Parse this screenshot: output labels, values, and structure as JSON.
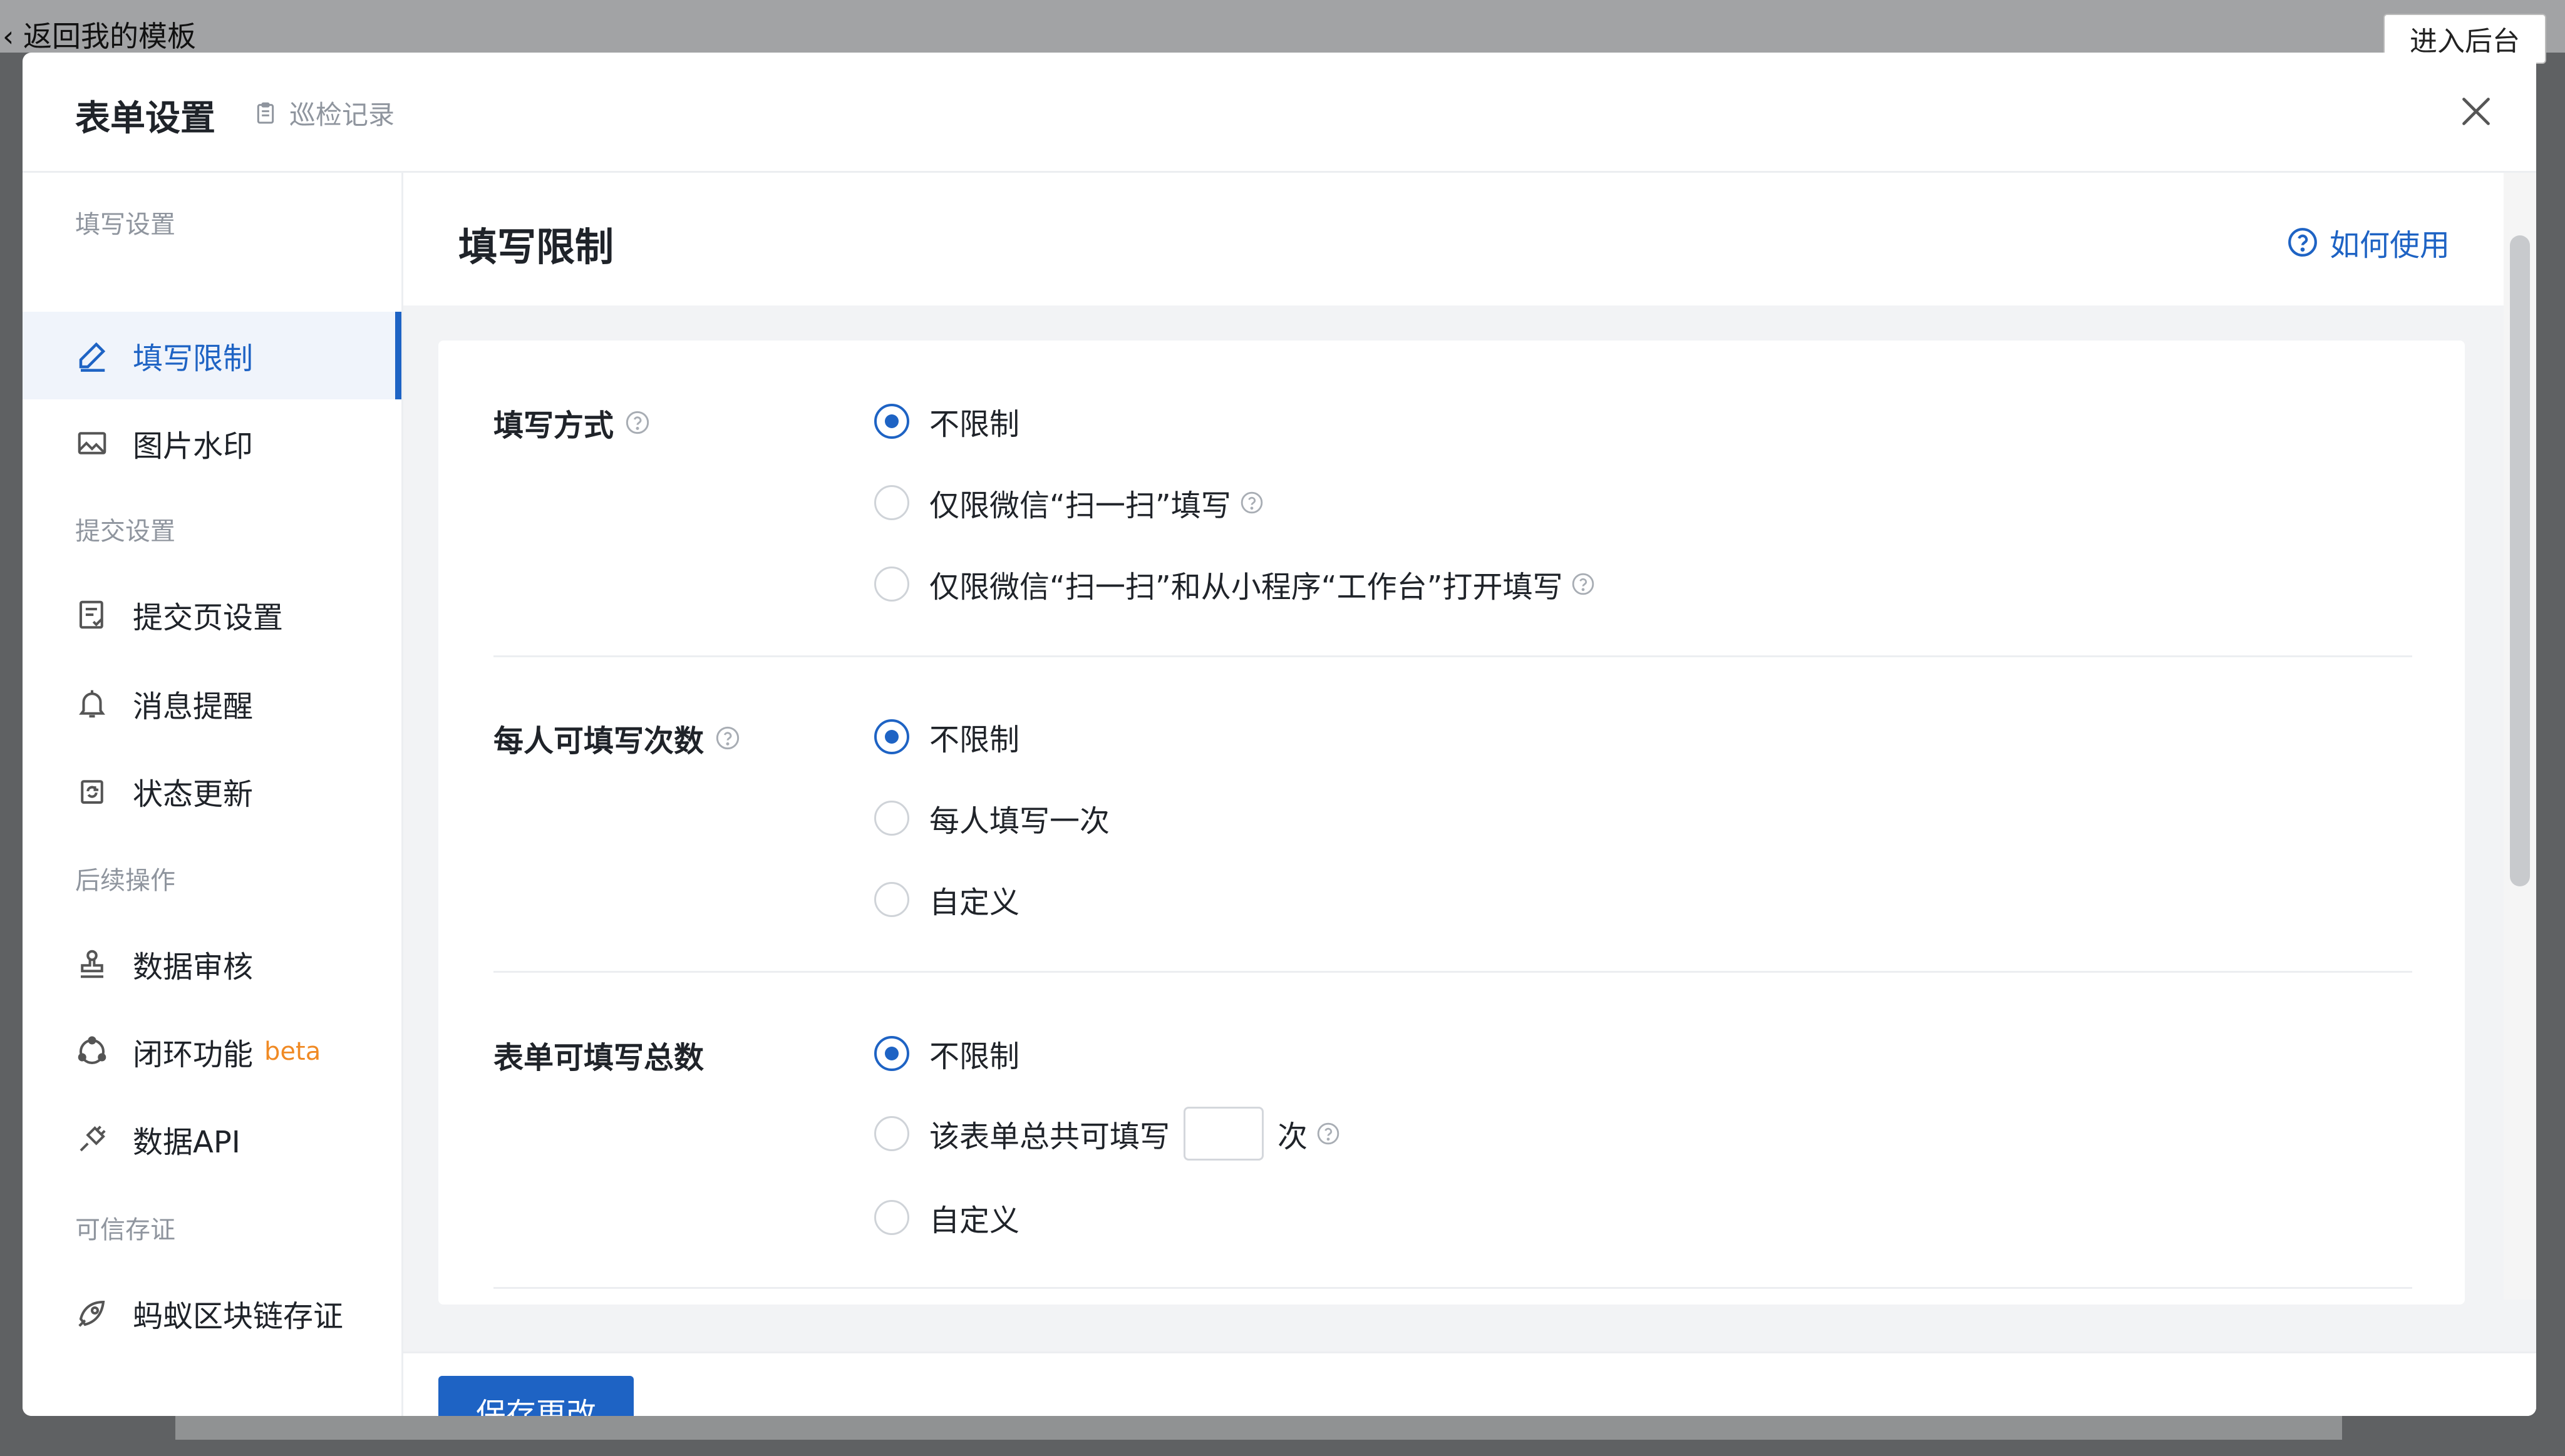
{
  "background": {
    "back_label": "返回我的模板",
    "enter_admin_label": "进入后台"
  },
  "modal": {
    "title": "表单设置",
    "patrol_link": "巡检记录",
    "close_icon": "close-icon"
  },
  "sidebar": {
    "groups": [
      {
        "title": "填写设置",
        "items": [
          {
            "label": "填写限制",
            "icon": "pencil-icon",
            "active": true
          },
          {
            "label": "图片水印",
            "icon": "image-icon",
            "active": false
          }
        ]
      },
      {
        "title": "提交设置",
        "items": [
          {
            "label": "提交页设置",
            "icon": "document-check-icon",
            "active": false
          },
          {
            "label": "消息提醒",
            "icon": "bell-icon",
            "active": false
          },
          {
            "label": "状态更新",
            "icon": "refresh-icon",
            "active": false
          }
        ]
      },
      {
        "title": "后续操作",
        "items": [
          {
            "label": "数据审核",
            "icon": "stamp-icon",
            "active": false
          },
          {
            "label": "闭环功能",
            "badge": "beta",
            "icon": "loop-icon",
            "active": false
          },
          {
            "label": "数据API",
            "icon": "plug-icon",
            "active": false
          }
        ]
      },
      {
        "title": "可信存证",
        "items": [
          {
            "label": "蚂蚁区块链存证",
            "icon": "blockchain-icon",
            "active": false
          }
        ]
      }
    ]
  },
  "main": {
    "title": "填写限制",
    "help_label": "如何使用",
    "sections": [
      {
        "label": "填写方式",
        "has_help": true,
        "options": [
          {
            "label": "不限制",
            "checked": true
          },
          {
            "label": "仅限微信“扫一扫”填写",
            "checked": false,
            "has_help": true
          },
          {
            "label": "仅限微信“扫一扫”和从小程序“工作台”打开填写",
            "checked": false,
            "has_help": true
          }
        ]
      },
      {
        "label": "每人可填写次数",
        "has_help": true,
        "options": [
          {
            "label": "不限制",
            "checked": true
          },
          {
            "label": "每人填写一次",
            "checked": false
          },
          {
            "label": "自定义",
            "checked": false
          }
        ]
      },
      {
        "label": "表单可填写总数",
        "has_help": false,
        "options": [
          {
            "label": "不限制",
            "checked": true
          },
          {
            "label_before": "该表单总共可填写",
            "input_value": "",
            "label_after": "次",
            "checked": false,
            "has_help": true
          },
          {
            "label": "自定义",
            "checked": false
          }
        ]
      }
    ],
    "save_label": "保存更改"
  },
  "colors": {
    "accent": "#1e63c4",
    "beta": "#f08a24",
    "muted": "#8f959e",
    "overlay": "#5f6163"
  }
}
